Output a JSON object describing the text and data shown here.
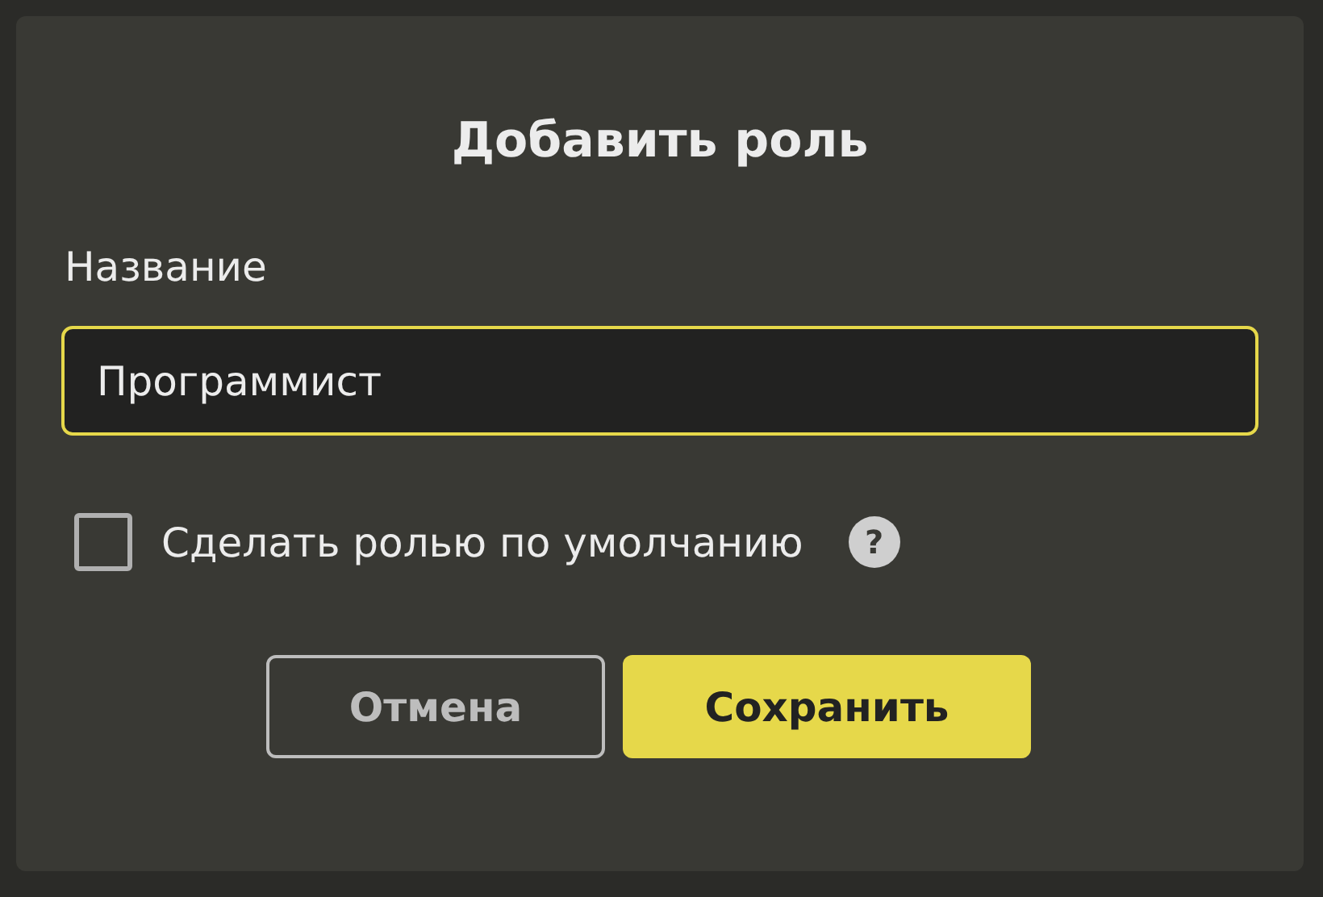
{
  "dialog": {
    "title": "Добавить роль"
  },
  "name_field": {
    "label": "Название",
    "value": "Программист",
    "focused": true
  },
  "default_checkbox": {
    "label": "Сделать ролью по умолчанию",
    "checked": false,
    "help": "?"
  },
  "buttons": [
    {
      "label": "Отмена",
      "kind": "secondary"
    },
    {
      "label": "Сохранить",
      "kind": "primary"
    }
  ]
}
